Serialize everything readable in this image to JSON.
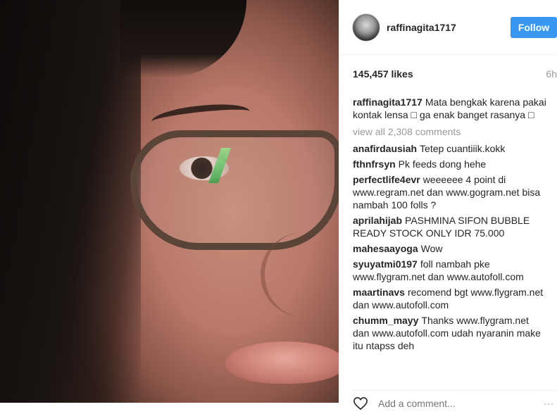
{
  "post": {
    "username": "raffinagita1717",
    "follow_label": "Follow",
    "likes": "145,457 likes",
    "time": "6h",
    "caption": {
      "user": "raffinagita1717",
      "text": "Mata bengkak karena pakai kontak lensa □ ga enak banget rasanya □"
    },
    "view_all": "view all 2,308 comments",
    "comments": [
      {
        "user": "anafirdausiah",
        "text": "Tetep cuantiiik.kokk"
      },
      {
        "user": "fthnfrsyn",
        "text": "Pk feeds dong hehe"
      },
      {
        "user": "perfectlife4evr",
        "text": "weeeeee 4 point di www.regram.net dan www.gogram.net bisa nambah 100 folls ?"
      },
      {
        "user": "aprilahijab",
        "text": "PASHMINA SIFON BUBBLE READY STOCK ONLY IDR 75.000"
      },
      {
        "user": "mahesaayoga",
        "text": "Wow"
      },
      {
        "user": "syuyatmi0197",
        "text": "foll nambah pke www.flygram.net dan www.autofoll.com"
      },
      {
        "user": "maartinavs",
        "text": "recomend bgt www.flygram.net dan www.autofoll.com"
      },
      {
        "user": "chumm_mayy",
        "text": "Thanks www.flygram.net dan www.autofoll.com udah nyaranin make itu ntapss deh"
      }
    ],
    "add_comment_placeholder": "Add a comment...",
    "more_label": "∙∙∙"
  },
  "icons": {
    "heart": "heart-outline-icon",
    "more": "more-options-icon"
  },
  "colors": {
    "follow_button": "#3897f0",
    "muted_text": "#999999"
  }
}
